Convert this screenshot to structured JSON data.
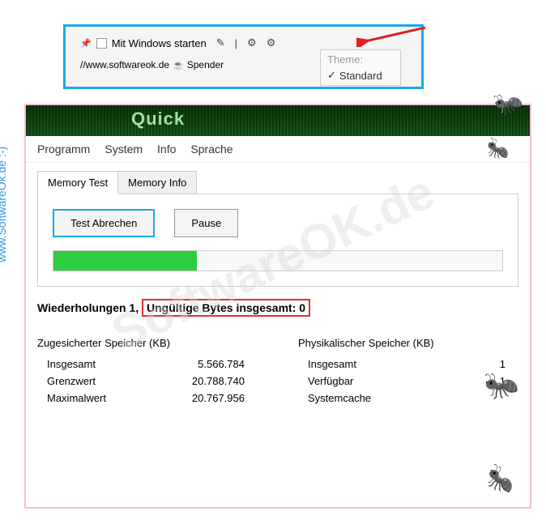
{
  "watermark": "SoftwareOK.de",
  "side_label": "www.SoftwareOk.de :-)",
  "top_widget": {
    "start_with_windows": "Mit Windows starten",
    "website": "//www.softwareok.de",
    "donate": "Spender",
    "theme_label": "Theme:",
    "theme_option": "Standard"
  },
  "app": {
    "title": "Quick",
    "menu": {
      "programm": "Programm",
      "system": "System",
      "info": "Info",
      "sprache": "Sprache"
    },
    "tabs": {
      "memory_test": "Memory Test",
      "memory_info": "Memory Info"
    },
    "buttons": {
      "abort": "Test Abrechen",
      "pause": "Pause"
    },
    "status": {
      "prefix": "Wiederholungen 1, ",
      "invalid_bytes": "Ungültige Bytes insgesamt: 0"
    },
    "committed": {
      "header": "Zugesicherter Speicher (KB)",
      "total_label": "Insgesamt",
      "total_val": "5.566.784",
      "limit_label": "Grenzwert",
      "limit_val": "20.788.740",
      "max_label": "Maximalwert",
      "max_val": "20.767.956"
    },
    "physical": {
      "header": "Physikalischer Speicher (KB)",
      "total_label": "Insgesamt",
      "total_val": "1",
      "avail_label": "Verfügbar",
      "avail_val": "1",
      "cache_label": "Systemcache",
      "cache_val": ""
    }
  }
}
